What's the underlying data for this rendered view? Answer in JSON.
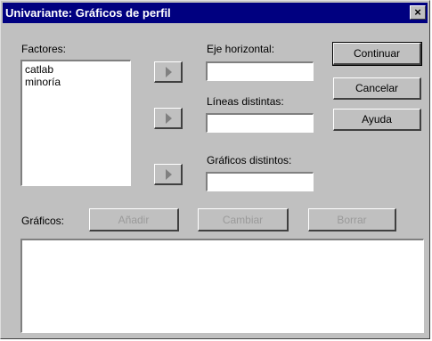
{
  "window": {
    "title": "Univariante: Gráficos de perfil",
    "close_glyph": "×"
  },
  "factors": {
    "label": "Factores:",
    "items": [
      "catlab",
      "minoría"
    ]
  },
  "fields": {
    "horizontal_label": "Eje horizontal:",
    "lines_label": "Líneas distintas:",
    "plots_label": "Gráficos distintos:",
    "horizontal_value": "",
    "lines_value": "",
    "plots_value": ""
  },
  "buttons": {
    "continue": "Continuar",
    "cancel": "Cancelar",
    "help": "Ayuda"
  },
  "plots": {
    "label": "Gráficos:",
    "add": "Añadir",
    "change": "Cambiar",
    "remove": "Borrar"
  },
  "icons": {
    "move_right": "triangle-right-icon"
  }
}
